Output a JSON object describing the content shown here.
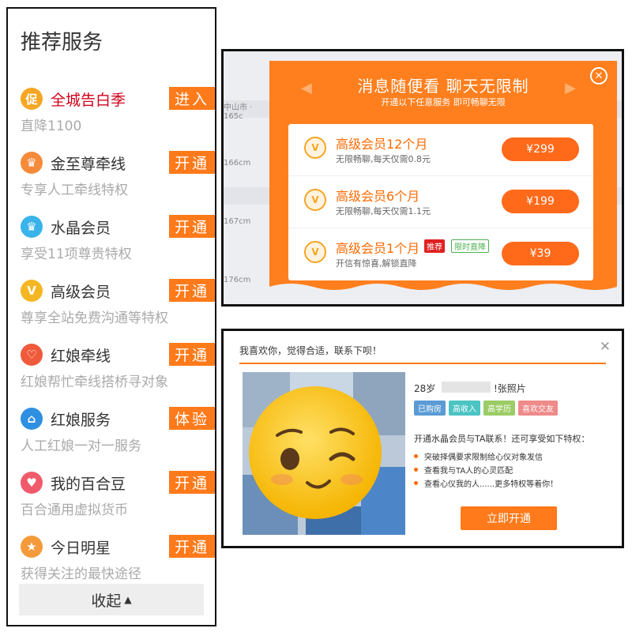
{
  "services": {
    "title": "推荐服务",
    "items": [
      {
        "name": "全城告白季",
        "desc": "直降1100",
        "button": "进入",
        "icon": "cu-icon",
        "icon_char": "促",
        "color": "#f5a623"
      },
      {
        "name": "金至尊牵线",
        "desc": "专享人工牵线特权",
        "button": "开通",
        "icon": "crown-icon",
        "icon_char": "♛",
        "color": "#f58a3a"
      },
      {
        "name": "水晶会员",
        "desc": "享受11项尊贵特权",
        "button": "开通",
        "icon": "crystal-crown-icon",
        "icon_char": "♛",
        "color": "#39b3ea"
      },
      {
        "name": "高级会员",
        "desc": "尊享全站免费沟通等特权",
        "button": "开通",
        "icon": "medal-icon",
        "icon_char": "V",
        "color": "#f5b623"
      },
      {
        "name": "红娘牵线",
        "desc": "红娘帮忙牵线搭桥寻对象",
        "button": "开通",
        "icon": "matchmaker-icon",
        "icon_char": "♡",
        "color": "#ef5a3a"
      },
      {
        "name": "红娘服务",
        "desc": "人工红娘一对一服务",
        "button": "体验",
        "icon": "home-heart-icon",
        "icon_char": "⌂",
        "color": "#2f8fe0"
      },
      {
        "name": "我的百合豆",
        "desc": "百合通用虚拟货币",
        "button": "开通",
        "icon": "lily-bean-icon",
        "icon_char": "♥",
        "color": "#f05a6a"
      },
      {
        "name": "今日明星",
        "desc": "获得关注的最快途径",
        "button": "开通",
        "icon": "star-icon",
        "icon_char": "★",
        "color": "#f59a3a"
      }
    ],
    "collapse_label": "收起"
  },
  "membership_popup": {
    "title": "消息随便看 聊天无限制",
    "subtitle": "开通以下任意服务 即可畅聊无限",
    "bg_rows": [
      "中山市 · 165c",
      "166cm",
      "167cm",
      "176cm"
    ],
    "plans": [
      {
        "name": "高级会员12个月",
        "desc": "无限畅聊,每天仅需0.8元",
        "price": "¥299"
      },
      {
        "name": "高级会员6个月",
        "desc": "无限畅聊,每天仅需1.1元",
        "price": "¥199"
      },
      {
        "name": "高级会员1个月",
        "desc": "开信有惊喜,解锁直降",
        "price": "¥39",
        "tag_recommend": "推荐",
        "tag_limited": "限时直降"
      }
    ]
  },
  "profile_popup": {
    "header": "我喜欢你，觉得合适，联系下呗！",
    "age_text": "28岁",
    "photos_text": "!张照片",
    "tags": [
      {
        "label": "已购房",
        "color": "#5b9bd5"
      },
      {
        "label": "高收入",
        "color": "#4bc4c4"
      },
      {
        "label": "高学历",
        "color": "#9ccc65"
      },
      {
        "label": "喜欢交友",
        "color": "#ef8a8a"
      }
    ],
    "privilege_title": "开通水晶会员与TA联系！还可享受如下特权：",
    "privileges": [
      "突破择偶要求限制给心仪对象发信",
      "查看我与TA人的心灵匹配",
      "查看心仪我的人......更多特权等着你！"
    ],
    "open_button": "立即开通"
  }
}
